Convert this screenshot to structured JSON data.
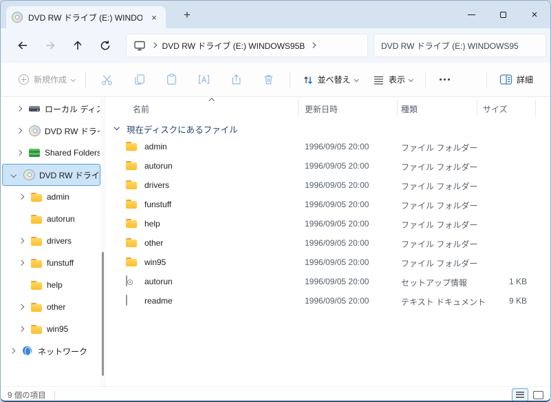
{
  "colors": {
    "accent": "#0b6ad1",
    "selection_bg": "#cce4f7",
    "titlebar_bg": "#d5e3f1"
  },
  "tab": {
    "title": "DVD RW ドライブ (E:) WINDOWS",
    "close_glyph": "×",
    "new_tab_glyph": "+"
  },
  "window": {
    "close_glyph": "×"
  },
  "breadcrumb": {
    "path": "DVD RW ドライブ (E:) WINDOWS95B"
  },
  "search": {
    "value": "DVD RW ドライブ (E:) WINDOWS95"
  },
  "toolbar": {
    "new_label": "新規作成",
    "sort_label": "並べ替え",
    "view_label": "表示",
    "details_label": "詳細"
  },
  "sidebar": {
    "items": [
      {
        "label": "ローカル ディスク",
        "icon": "drive-icon"
      },
      {
        "label": "DVD RW ドライブ",
        "icon": "dvd-icon"
      },
      {
        "label": "Shared Folders",
        "icon": "shared-folders-icon"
      },
      {
        "label": "DVD RW ドライブ",
        "icon": "dvd-icon",
        "selected": true
      },
      {
        "label": "admin",
        "icon": "folder-icon"
      },
      {
        "label": "autorun",
        "icon": "folder-icon"
      },
      {
        "label": "drivers",
        "icon": "folder-icon"
      },
      {
        "label": "funstuff",
        "icon": "folder-icon"
      },
      {
        "label": "help",
        "icon": "folder-icon"
      },
      {
        "label": "other",
        "icon": "folder-icon"
      },
      {
        "label": "win95",
        "icon": "folder-icon"
      },
      {
        "label": "ネットワーク",
        "icon": "network-icon"
      }
    ]
  },
  "columns": {
    "name": "名前",
    "modified": "更新日時",
    "type": "種類",
    "size": "サイズ"
  },
  "group": {
    "label": "現在ディスクにあるファイル"
  },
  "files": [
    {
      "name": "admin",
      "date": "1996/09/05 20:00",
      "type": "ファイル フォルダー",
      "size": "",
      "icon": "folder-icon"
    },
    {
      "name": "autorun",
      "date": "1996/09/05 20:00",
      "type": "ファイル フォルダー",
      "size": "",
      "icon": "folder-icon"
    },
    {
      "name": "drivers",
      "date": "1996/09/05 20:00",
      "type": "ファイル フォルダー",
      "size": "",
      "icon": "folder-icon"
    },
    {
      "name": "funstuff",
      "date": "1996/09/05 20:00",
      "type": "ファイル フォルダー",
      "size": "",
      "icon": "folder-icon"
    },
    {
      "name": "help",
      "date": "1996/09/05 20:00",
      "type": "ファイル フォルダー",
      "size": "",
      "icon": "folder-icon"
    },
    {
      "name": "other",
      "date": "1996/09/05 20:00",
      "type": "ファイル フォルダー",
      "size": "",
      "icon": "folder-icon"
    },
    {
      "name": "win95",
      "date": "1996/09/05 20:00",
      "type": "ファイル フォルダー",
      "size": "",
      "icon": "folder-icon"
    },
    {
      "name": "autorun",
      "date": "1996/09/05 20:00",
      "type": "セットアップ情報",
      "size": "1 KB",
      "icon": "setup-info-icon"
    },
    {
      "name": "readme",
      "date": "1996/09/05 20:00",
      "type": "テキスト ドキュメント",
      "size": "9 KB",
      "icon": "text-document-icon"
    }
  ],
  "statusbar": {
    "count": "9 個の項目"
  }
}
